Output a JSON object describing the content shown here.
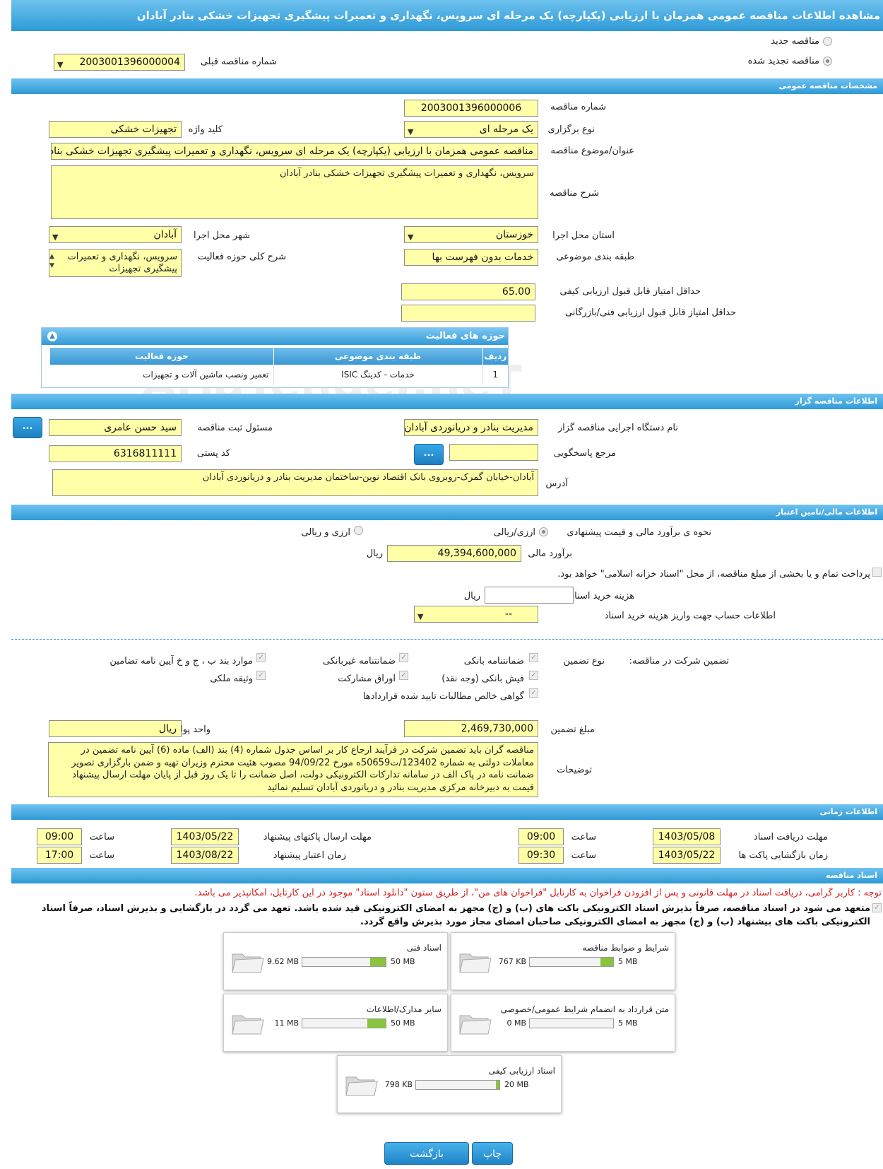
{
  "title": "مشاهده اطلاعات مناقصه عمومی همزمان با ارزیابی (یکپارچه) یک مرحله ای سرویس، نگهداری و تعمیرات پیشگیری تجهیزات خشکی بنادر آبادان",
  "top": {
    "new_label": "مناقصه جدید",
    "renewed_label": "مناقصه تجدید شده",
    "prev_label": "شماره مناقصه قبلی",
    "prev_value": "2003001396000004"
  },
  "sections": {
    "general": "مشخصات مناقصه عمومی",
    "organizer": "اطلاعات مناقصه گزار",
    "finance": "اطلاعات مالی/تامین اعتبار",
    "time": "اطلاعات زمانی",
    "docs": "اسناد مناقصه"
  },
  "general": {
    "number_label": "شماره مناقصه",
    "number": "2003001396000006",
    "type_label": "نوع برگزاری",
    "type": "یک مرحله ای",
    "keyword_label": "کلید واژه",
    "keyword": "تجهیزات خشکی",
    "subject_label": "عنوان/موضوع مناقصه",
    "subject": "مناقصه عمومی همزمان با ارزیابی (یکپارچه) یک مرحله ای سرویس، نگهداری و تعمیرات پیشگیری تجهیزات خشکی بنادر آبادان",
    "desc_label": "شرح مناقصه",
    "desc": "سرویس، نگهداری و تعمیرات پیشگیری تجهیزات خشکی بنادر آبادان",
    "province_label": "استان محل اجرا",
    "province": "خوزستان",
    "city_label": "شهر محل اجرا",
    "city": "آبادان",
    "category_label": "طبقه بندی موضوعی",
    "category": "خدمات بدون فهرست بها",
    "activity_label": "شرح کلی حوزه فعالیت",
    "activity": "سرویس، نگهداری و تعمیرات پیشگیری تجهیزات",
    "min_quality_label": "حداقل امتیاز قابل قبول ارزیابی کیفی",
    "min_quality": "65.00",
    "min_tech_label": "حداقل امتیاز قابل قبول ارزیابی فنی/بازرگانی",
    "min_tech": ""
  },
  "activity_panel": {
    "title": "حوزه های فعالیت",
    "headers": [
      "ردیف",
      "طبقه بندی موضوعی",
      "حوزه فعالیت"
    ],
    "rows": [
      [
        "1",
        "خدمات - کدینگ ISIC",
        "تعمیر ونصب ماشین آلات و تجهیزات"
      ]
    ]
  },
  "organizer": {
    "org_label": "نام دستگاه اجرایی مناقصه گزار",
    "org": "مدیریت بنادر و دریانوردی آبادان",
    "resp_label": "مسئول ثبت مناقصه",
    "resp": "سید حسن  عامری",
    "ref_label": "مرجع پاسخگویی",
    "ref": "",
    "postal_label": "کد پستی",
    "postal": "6316811111",
    "address_label": "آدرس",
    "address": "آبادان-خیابان گمرک-روبروی بانک اقتصاد نوین-ساختمان مدیریت بنادر و دریانوردی آبادان",
    "dots": "..."
  },
  "finance": {
    "method_label": "نحوه ی برآورد مالی و قیمت پیشنهادی",
    "opt1": "ارزی/ریالی",
    "opt2": "ارزی و ریالی",
    "estimate_label": "برآورد مالی",
    "estimate": "49,394,600,000",
    "rial": "ریال",
    "treasury_text": "پرداخت تمام و یا بخشی از مبلغ مناقصه، از محل \"اسناد خزانه اسلامی\" خواهد بود.",
    "doc_cost_label": "هزینه خرید اسناد",
    "doc_cost": "",
    "account_label": "اطلاعات حساب جهت واریز هزینه خرید اسناد",
    "account": "--"
  },
  "guarantee": {
    "label": "تضمین شرکت در مناقصه:",
    "type_label": "نوع تضمین",
    "items": [
      "ضمانتنامه بانکی",
      "ضمانتنامه غیربانکی",
      "موارد بند ب ، ج و خ آیین نامه تضامین",
      "فیش بانکی (وجه نقد)",
      "اوراق مشارکت",
      "وثیقه ملکی",
      "گواهی خالص مطالبات تایید شده قراردادها"
    ],
    "amount_label": "مبلغ تضمین",
    "amount": "2,469,730,000",
    "unit_label": "واحد پول",
    "unit": "ریال",
    "notes_label": "توضیحات",
    "notes": "مناقصه گران باید تضمین شرکت در فرآیند ارجاع کار بر اساس جدول شماره (4) بند (الف) ماده (6) آیین نامه تضمین در معاملات دولتی به شماره 123402/ت50659ه مورخ 94/09/22 مصوب هئیت محترم وزیران تهیه و ضمن بارگزاری تصویر ضمانت نامه در پاک الف در سامانه تدارکات الکترونیکی دولت، اصل ضمانت را تا یک روز قبل از پایان مهلت ارسال پیشنهاد قیمت به دبیرخانه مرکزی مدیریت بنادر و دریانوردی آبادان تسلیم نمائید"
  },
  "time": {
    "receive_label": "مهلت دریافت اسناد",
    "receive_date": "1403/05/08",
    "receive_time": "09:00",
    "send_label": "مهلت ارسال پاکتهای پیشنهاد",
    "send_date": "1403/05/22",
    "send_time": "09:00",
    "open_label": "زمان بازگشایی پاکت ها",
    "open_date": "1403/05/22",
    "open_time": "09:30",
    "valid_label": "زمان اعتبار پیشنهاد",
    "valid_date": "1403/08/22",
    "valid_time": "17:00",
    "hour": "ساعت"
  },
  "docs": {
    "notice": "توجه : کاربر گرامی، دریافت اسناد در مهلت قانونی و پس از افزودن فراخوان به کارتابل \"فراخوان های من\"، از طریق ستون \"دانلود اسناد\" موجود در این کارتابل، امکانپذیر می باشد.",
    "commit": "متعهد می شود در اسناد مناقصه، صرفاً بذیرش اسناد الکترونیکی باکت های (ب) و (ج) مجهز به امضای الکترونیکی قید شده باشد. تعهد می گردد در بازگشایی و بذیرش اسناد، صرفاً اسناد الکترونیکی باکت های بیشنهاد (ب) و (ج) مجهز به امضای الکترونیکی صاحبان امضای مجاز مورد بذیرش واقع گردد.",
    "files": [
      {
        "name": "شرایط و ضوابط مناقصه",
        "used": "767 KB",
        "max": "5 MB",
        "fill": 0.15
      },
      {
        "name": "اسناد فنی",
        "used": "9.62 MB",
        "max": "50 MB",
        "fill": 0.19
      },
      {
        "name": "متن قرارداد به انضمام شرایط عمومی/خصوصی",
        "used": "0 MB",
        "max": "5 MB",
        "fill": 0
      },
      {
        "name": "سایر مدارک/اطلاعات",
        "used": "11 MB",
        "max": "50 MB",
        "fill": 0.22
      },
      {
        "name": "اسناد ارزیابی کیفی",
        "used": "798 KB",
        "max": "20 MB",
        "fill": 0.04
      }
    ]
  },
  "buttons": {
    "print": "چاپ",
    "back": "بازگشت"
  },
  "watermark": "AriaTender.neT",
  "colors": {
    "field": "#ffffa8",
    "bar": "#2f9ad6",
    "progress": "#88c43c",
    "notice": "#d02020"
  }
}
